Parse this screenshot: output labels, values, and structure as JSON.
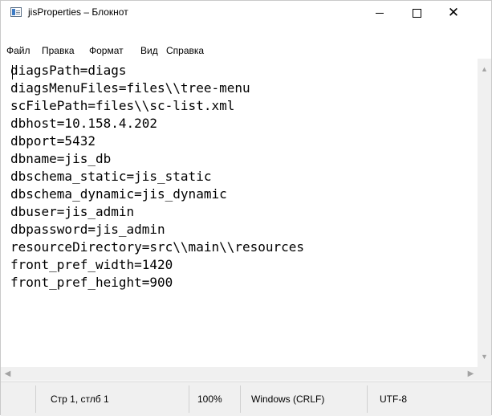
{
  "window": {
    "title": "jisProperties – Блокнот",
    "controls": {
      "minimize": "minimize",
      "maximize": "maximize",
      "close": "✕"
    }
  },
  "menu": [
    "Файл",
    "Правка",
    "Формат",
    "Вид",
    "Справка"
  ],
  "editor": {
    "lines": [
      "diagsPath=diags",
      "diagsMenuFiles=files\\\\tree-menu",
      "scFilePath=files\\\\sc-list.xml",
      "dbhost=10.158.4.202",
      "dbport=5432",
      "dbname=jis_db",
      "dbschema_static=jis_static",
      "dbschema_dynamic=jis_dynamic",
      "dbuser=jis_admin",
      "dbpassword=jis_admin",
      "resourceDirectory=src\\\\main\\\\resources",
      "front_pref_width=1420",
      "front_pref_height=900"
    ]
  },
  "status": {
    "position": "Стр 1, стлб 1",
    "zoom": "100%",
    "line_endings": "Windows (CRLF)",
    "encoding": "UTF-8"
  },
  "icons": {
    "app": "notepad-icon",
    "scroll_up": "chevron-up-icon",
    "scroll_down": "chevron-down-icon",
    "scroll_left": "chevron-left-icon",
    "scroll_right": "chevron-right-icon"
  }
}
